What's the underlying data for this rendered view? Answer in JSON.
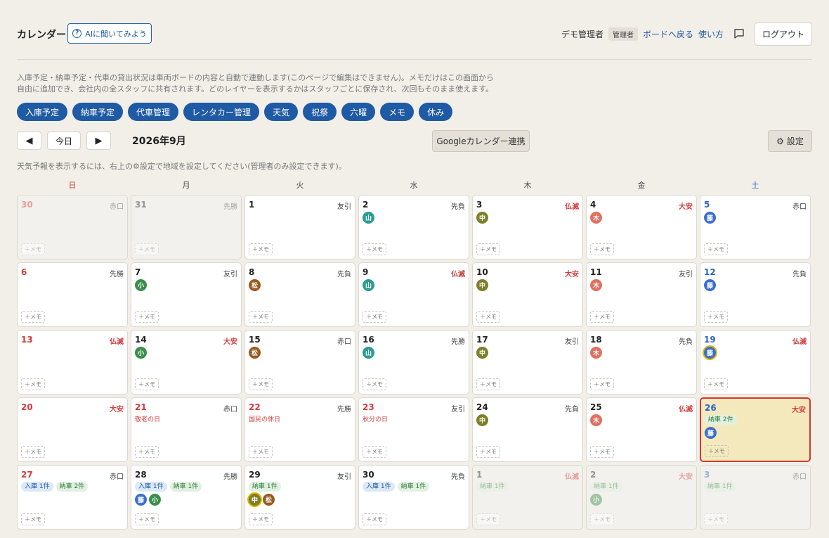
{
  "header": {
    "title": "カレンダー",
    "ai_button": "AIに聞いてみよう",
    "user_name": "デモ管理者",
    "role": "管理者",
    "board_link": "ボードへ戻る",
    "help_link": "使い方",
    "logout": "ログアウト"
  },
  "description": "入庫予定・納車予定・代車の貸出状況は車両ボードの内容と自動で連動します(このページで編集はできません)。メモだけはこの画面から自由に追加でき、会社内の全スタッフに共有されます。どのレイヤーを表示するかはスタッフごとに保存され、次回もそのまま使えます。",
  "layers": [
    "入庫予定",
    "納車予定",
    "代車管理",
    "レンタカー管理",
    "天気",
    "祝祭",
    "六曜",
    "メモ",
    "休み"
  ],
  "nav": {
    "prev": "◀",
    "today": "今日",
    "next": "▶",
    "month": "2026年9月",
    "gcal": "Googleカレンダー連携",
    "settings": "設定"
  },
  "notice": "天気予報を表示するには、右上の⚙設定で地域を設定してください(管理者のみ設定できます)。",
  "weekdays": [
    "日",
    "月",
    "火",
    "水",
    "木",
    "金",
    "土"
  ],
  "memo_label": "＋メモ",
  "staff_colors": {
    "山": "#2a9d8f",
    "中": "#7d7f2a",
    "木": "#e07060",
    "藤": "#3a6fcf",
    "小": "#3a8f4a",
    "松": "#9a5a20"
  },
  "days": [
    {
      "d": "30",
      "r": "赤口",
      "out": true,
      "st": []
    },
    {
      "d": "31",
      "r": "先勝",
      "out": true,
      "st": []
    },
    {
      "d": "1",
      "r": "友引",
      "st": []
    },
    {
      "d": "2",
      "r": "先負",
      "st": [
        "山"
      ]
    },
    {
      "d": "3",
      "r": "仏滅",
      "rr": true,
      "st": [
        "中"
      ]
    },
    {
      "d": "4",
      "r": "大安",
      "rr": true,
      "st": [
        "木"
      ]
    },
    {
      "d": "5",
      "r": "赤口",
      "st": [
        "藤"
      ]
    },
    {
      "d": "6",
      "r": "先勝",
      "st": []
    },
    {
      "d": "7",
      "r": "友引",
      "st": [
        "小"
      ]
    },
    {
      "d": "8",
      "r": "先負",
      "st": [
        "松"
      ]
    },
    {
      "d": "9",
      "r": "仏滅",
      "rr": true,
      "st": [
        "山"
      ]
    },
    {
      "d": "10",
      "r": "大安",
      "rr": true,
      "st": [
        "中"
      ]
    },
    {
      "d": "11",
      "r": "友引",
      "st": [
        "木"
      ]
    },
    {
      "d": "12",
      "r": "先負",
      "st": [
        "藤"
      ]
    },
    {
      "d": "13",
      "r": "仏滅",
      "rr": true,
      "st": []
    },
    {
      "d": "14",
      "r": "大安",
      "rr": true,
      "st": [
        "小"
      ]
    },
    {
      "d": "15",
      "r": "赤口",
      "st": [
        "松"
      ]
    },
    {
      "d": "16",
      "r": "先勝",
      "st": [
        "山"
      ]
    },
    {
      "d": "17",
      "r": "友引",
      "st": [
        "中"
      ]
    },
    {
      "d": "18",
      "r": "先負",
      "st": [
        "木"
      ]
    },
    {
      "d": "19",
      "r": "仏滅",
      "rr": true,
      "st": [
        "藤"
      ],
      "ring": [
        "藤"
      ]
    },
    {
      "d": "20",
      "r": "大安",
      "rr": true,
      "st": []
    },
    {
      "d": "21",
      "r": "赤口",
      "hol": "敬老の日",
      "st": []
    },
    {
      "d": "22",
      "r": "先勝",
      "hol": "国民の休日",
      "st": []
    },
    {
      "d": "23",
      "r": "友引",
      "hol": "秋分の日",
      "st": []
    },
    {
      "d": "24",
      "r": "先負",
      "st": [
        "中"
      ]
    },
    {
      "d": "25",
      "r": "仏滅",
      "rr": true,
      "st": [
        "木"
      ]
    },
    {
      "d": "26",
      "r": "大安",
      "rr": true,
      "today": true,
      "tags": [
        {
          "k": "out2",
          "t": "納車 2件"
        }
      ],
      "st": [
        "藤"
      ]
    },
    {
      "d": "27",
      "r": "赤口",
      "tags": [
        {
          "k": "in",
          "t": "入庫 1件"
        },
        {
          "k": "out2",
          "t": "納車 2件"
        }
      ],
      "st": []
    },
    {
      "d": "28",
      "r": "先勝",
      "tags": [
        {
          "k": "in",
          "t": "入庫 1件"
        },
        {
          "k": "out2",
          "t": "納車 1件"
        }
      ],
      "st": [
        "藤",
        "小"
      ]
    },
    {
      "d": "29",
      "r": "友引",
      "tags": [
        {
          "k": "out2",
          "t": "納車 1件"
        }
      ],
      "st": [
        "中",
        "松"
      ],
      "ring": [
        "中"
      ]
    },
    {
      "d": "30",
      "r": "先負",
      "tags": [
        {
          "k": "in",
          "t": "入庫 1件"
        },
        {
          "k": "out2",
          "t": "納車 1件"
        }
      ],
      "st": []
    },
    {
      "d": "1",
      "r": "仏滅",
      "rr": true,
      "out": true,
      "tags": [
        {
          "k": "out2",
          "t": "納車 1件"
        }
      ],
      "st": []
    },
    {
      "d": "2",
      "r": "大安",
      "rr": true,
      "out": true,
      "tags": [
        {
          "k": "out2",
          "t": "納車 1件"
        }
      ],
      "st": [
        "小"
      ]
    },
    {
      "d": "3",
      "r": "赤口",
      "out": true,
      "tags": [
        {
          "k": "out2",
          "t": "納車 1件"
        }
      ],
      "st": []
    }
  ]
}
